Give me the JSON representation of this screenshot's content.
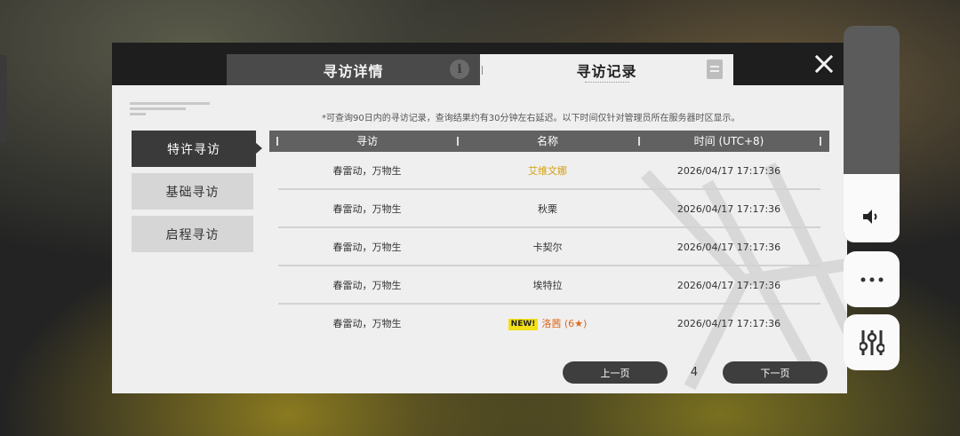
{
  "dialog": {
    "tabs": [
      {
        "label": "寻访详情",
        "active": false
      },
      {
        "label": "寻访记录",
        "active": true
      }
    ],
    "close_icon": "close-x-icon",
    "notice": "*可查询90日内的寻访记录，查询结果约有30分钟左右延迟。以下时间仅针对管理员所在服务器时区显示。",
    "sidebar": {
      "items": [
        {
          "label": "特许寻访",
          "active": true
        },
        {
          "label": "基础寻访",
          "active": false
        },
        {
          "label": "启程寻访",
          "active": false
        }
      ]
    },
    "table": {
      "headers": [
        "寻访",
        "名称",
        "时间 (UTC+8)"
      ],
      "rows": [
        {
          "banner": "春雷动，万物生",
          "name": "艾维文娜",
          "time": "2026/04/17 17:17:36",
          "highlight": "gold"
        },
        {
          "banner": "春雷动，万物生",
          "name": "秋栗",
          "time": "2026/04/17 17:17:36"
        },
        {
          "banner": "春雷动，万物生",
          "name": "卡契尔",
          "time": "2026/04/17 17:17:36"
        },
        {
          "banner": "春雷动，万物生",
          "name": "埃特拉",
          "time": "2026/04/17 17:17:36"
        },
        {
          "banner": "春雷动，万物生",
          "badge": "NEW!",
          "name": "洛茜 (6★)",
          "time": "2026/04/17 17:17:36",
          "highlight": "orange"
        }
      ]
    },
    "pagination": {
      "prev_label": "上一页",
      "page": "4",
      "next_label": "下一页"
    }
  },
  "side_controls": {
    "volume_icon": "speaker-icon",
    "more_icon": "more-dots-icon",
    "settings_icon": "sliders-icon"
  },
  "colors": {
    "gold": "#d4a010",
    "orange": "#e0681a",
    "dark": "#3a3a3a",
    "badge": "#f3e117"
  }
}
